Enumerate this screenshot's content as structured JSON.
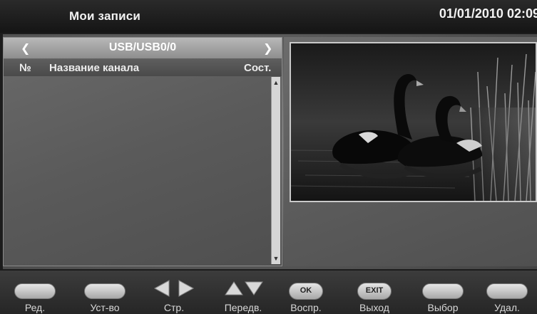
{
  "header": {
    "title": "Мои записи",
    "datetime": "01/01/2010 02:09"
  },
  "source": {
    "prev_icon": "chevron-left-icon",
    "label": "USB/USB0/0",
    "next_icon": "chevron-right-icon"
  },
  "columns": {
    "number": "№",
    "channel_name": "Название канала",
    "status": "Сост."
  },
  "footer": {
    "keys": [
      {
        "label": "Ред.",
        "type": "colored-button"
      },
      {
        "label": "Уст-во",
        "type": "colored-button"
      },
      {
        "label": "Стр.",
        "type": "left-right-arrows-icon"
      },
      {
        "label": "Передв.",
        "type": "up-down-arrows-icon"
      },
      {
        "label": "Воспр.",
        "button_text": "OK"
      },
      {
        "label": "Выход",
        "button_text": "EXIT"
      },
      {
        "label": "Выбор",
        "type": "colored-button"
      },
      {
        "label": "Удал.",
        "type": "colored-button"
      }
    ]
  }
}
